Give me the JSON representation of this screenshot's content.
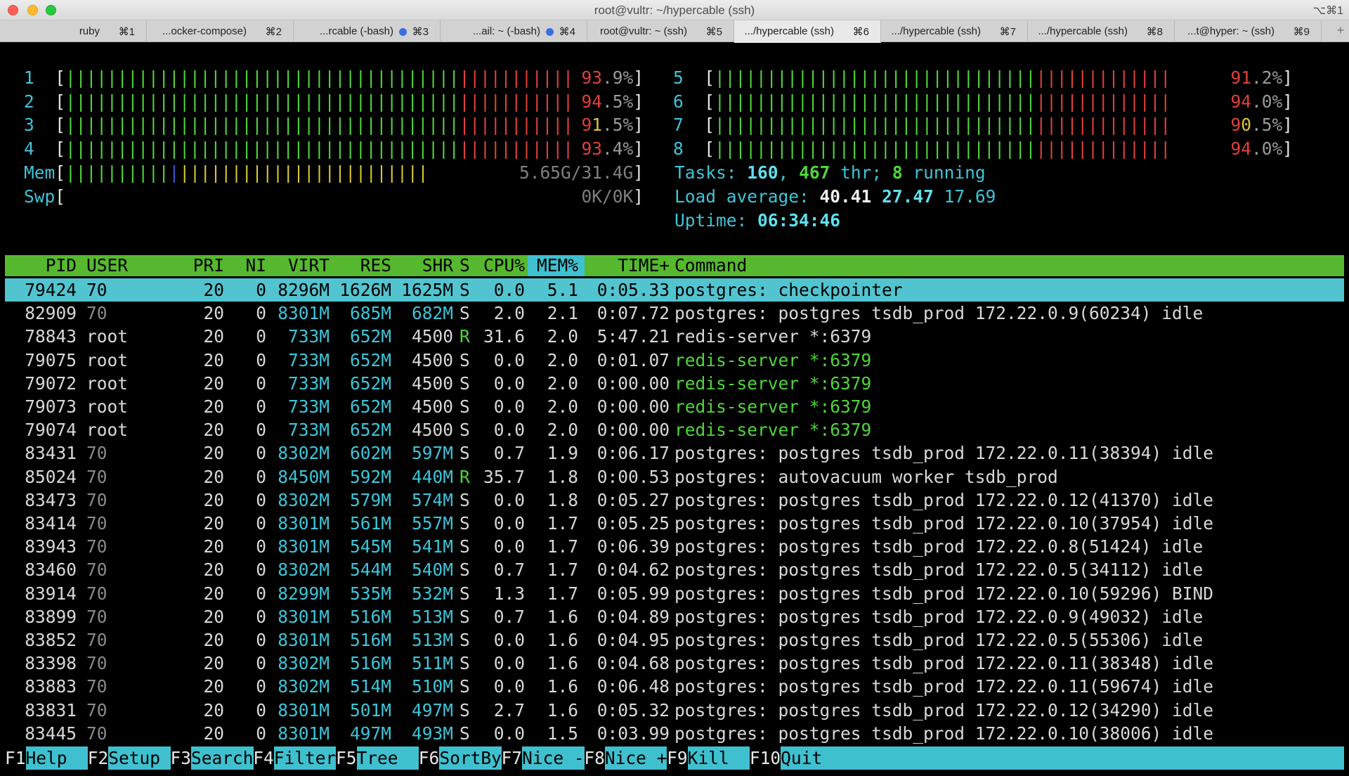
{
  "window": {
    "title": "root@vultr: ~/hypercable (ssh)",
    "shortcut": "⌥⌘1"
  },
  "tabs": [
    {
      "label": "ruby",
      "key": "⌘1",
      "dot": false,
      "active": false
    },
    {
      "label": "...ocker-compose)",
      "key": "⌘2",
      "dot": false,
      "active": false
    },
    {
      "label": "...rcable (-bash)",
      "key": "⌘3",
      "dot": true,
      "active": false
    },
    {
      "label": "...ail: ~ (-bash)",
      "key": "⌘4",
      "dot": true,
      "active": false
    },
    {
      "label": "root@vultr: ~ (ssh)",
      "key": "⌘5",
      "dot": false,
      "active": false
    },
    {
      "label": ".../hypercable (ssh)",
      "key": "⌘6",
      "dot": false,
      "active": true
    },
    {
      "label": ".../hypercable (ssh)",
      "key": "⌘7",
      "dot": false,
      "active": false
    },
    {
      "label": ".../hypercable (ssh)",
      "key": "⌘8",
      "dot": false,
      "active": false
    },
    {
      "label": "...t@hyper: ~ (ssh)",
      "key": "⌘9",
      "dot": false,
      "active": false
    }
  ],
  "cpus": [
    {
      "id": "1",
      "value": "93.9%]",
      "green": 38,
      "red": 11,
      "yellow": 0
    },
    {
      "id": "2",
      "value": "94.5%]",
      "green": 38,
      "red": 11,
      "yellow": 0
    },
    {
      "id": "3",
      "value": "91.5%]",
      "green": 38,
      "red": 11,
      "yellow": 1
    },
    {
      "id": "4",
      "value": "93.4%]",
      "green": 38,
      "red": 11,
      "yellow": 0
    },
    {
      "id": "5",
      "value": "91.2%]",
      "green": 31,
      "red": 13,
      "yellow": 0
    },
    {
      "id": "6",
      "value": "94.0%]",
      "green": 31,
      "red": 13,
      "yellow": 0
    },
    {
      "id": "7",
      "value": "90.5%]",
      "green": 31,
      "red": 13,
      "yellow": 1
    },
    {
      "id": "8",
      "value": "94.0%]",
      "green": 31,
      "red": 13,
      "yellow": 0
    }
  ],
  "mem": {
    "label": "Mem",
    "value": "5.65G/31.4G]",
    "green": 10,
    "blue": 1,
    "yellow": 24
  },
  "swp": {
    "label": "Swp",
    "value": "0K/0K]"
  },
  "tasks": {
    "label": "Tasks:",
    "count": "160",
    "thr": "467",
    "thr_label": "thr;",
    "running": "8",
    "running_label": "running"
  },
  "load": {
    "label": "Load average:",
    "one": "40.41",
    "five": "27.47",
    "fifteen": "17.69"
  },
  "uptime": {
    "label": "Uptime:",
    "value": "06:34:46"
  },
  "columns": {
    "pid": "PID",
    "user": "USER",
    "pri": "PRI",
    "ni": "NI",
    "virt": "VIRT",
    "res": "RES",
    "shr": "SHR",
    "s": "S",
    "cpu": "CPU%",
    "mem": "MEM%",
    "time": "TIME+",
    "command": "Command"
  },
  "processes": [
    {
      "pid": "79424",
      "user": "70",
      "pri": "20",
      "ni": "0",
      "virt": "8296M",
      "res": "1626M",
      "shr": "1625M",
      "s": "S",
      "cpu": "0.0",
      "mem": "5.1",
      "time": "0:05.33",
      "command": "postgres: checkpointer",
      "thread": false
    },
    {
      "pid": "82909",
      "user": "70",
      "pri": "20",
      "ni": "0",
      "virt": "8301M",
      "res": "685M",
      "shr": "682M",
      "s": "S",
      "cpu": "2.0",
      "mem": "2.1",
      "time": "0:07.72",
      "command": "postgres: postgres tsdb_prod 172.22.0.9(60234) idle",
      "thread": false
    },
    {
      "pid": "78843",
      "user": "root",
      "pri": "20",
      "ni": "0",
      "virt": "733M",
      "res": "652M",
      "shr": "4500",
      "s": "R",
      "cpu": "31.6",
      "mem": "2.0",
      "time": "5:47.21",
      "command": "redis-server *:6379",
      "thread": false
    },
    {
      "pid": "79075",
      "user": "root",
      "pri": "20",
      "ni": "0",
      "virt": "733M",
      "res": "652M",
      "shr": "4500",
      "s": "S",
      "cpu": "0.0",
      "mem": "2.0",
      "time": "0:01.07",
      "command": "redis-server *:6379",
      "thread": true
    },
    {
      "pid": "79072",
      "user": "root",
      "pri": "20",
      "ni": "0",
      "virt": "733M",
      "res": "652M",
      "shr": "4500",
      "s": "S",
      "cpu": "0.0",
      "mem": "2.0",
      "time": "0:00.00",
      "command": "redis-server *:6379",
      "thread": true
    },
    {
      "pid": "79073",
      "user": "root",
      "pri": "20",
      "ni": "0",
      "virt": "733M",
      "res": "652M",
      "shr": "4500",
      "s": "S",
      "cpu": "0.0",
      "mem": "2.0",
      "time": "0:00.00",
      "command": "redis-server *:6379",
      "thread": true
    },
    {
      "pid": "79074",
      "user": "root",
      "pri": "20",
      "ni": "0",
      "virt": "733M",
      "res": "652M",
      "shr": "4500",
      "s": "S",
      "cpu": "0.0",
      "mem": "2.0",
      "time": "0:00.00",
      "command": "redis-server *:6379",
      "thread": true
    },
    {
      "pid": "83431",
      "user": "70",
      "pri": "20",
      "ni": "0",
      "virt": "8302M",
      "res": "602M",
      "shr": "597M",
      "s": "S",
      "cpu": "0.7",
      "mem": "1.9",
      "time": "0:06.17",
      "command": "postgres: postgres tsdb_prod 172.22.0.11(38394) idle",
      "thread": false
    },
    {
      "pid": "85024",
      "user": "70",
      "pri": "20",
      "ni": "0",
      "virt": "8450M",
      "res": "592M",
      "shr": "440M",
      "s": "R",
      "cpu": "35.7",
      "mem": "1.8",
      "time": "0:00.53",
      "command": "postgres: autovacuum worker tsdb_prod",
      "thread": false
    },
    {
      "pid": "83473",
      "user": "70",
      "pri": "20",
      "ni": "0",
      "virt": "8302M",
      "res": "579M",
      "shr": "574M",
      "s": "S",
      "cpu": "0.0",
      "mem": "1.8",
      "time": "0:05.27",
      "command": "postgres: postgres tsdb_prod 172.22.0.12(41370) idle",
      "thread": false
    },
    {
      "pid": "83414",
      "user": "70",
      "pri": "20",
      "ni": "0",
      "virt": "8301M",
      "res": "561M",
      "shr": "557M",
      "s": "S",
      "cpu": "0.0",
      "mem": "1.7",
      "time": "0:05.25",
      "command": "postgres: postgres tsdb_prod 172.22.0.10(37954) idle",
      "thread": false
    },
    {
      "pid": "83943",
      "user": "70",
      "pri": "20",
      "ni": "0",
      "virt": "8301M",
      "res": "545M",
      "shr": "541M",
      "s": "S",
      "cpu": "0.0",
      "mem": "1.7",
      "time": "0:06.39",
      "command": "postgres: postgres tsdb_prod 172.22.0.8(51424) idle",
      "thread": false
    },
    {
      "pid": "83460",
      "user": "70",
      "pri": "20",
      "ni": "0",
      "virt": "8302M",
      "res": "544M",
      "shr": "540M",
      "s": "S",
      "cpu": "0.7",
      "mem": "1.7",
      "time": "0:04.62",
      "command": "postgres: postgres tsdb_prod 172.22.0.5(34112) idle",
      "thread": false
    },
    {
      "pid": "83914",
      "user": "70",
      "pri": "20",
      "ni": "0",
      "virt": "8299M",
      "res": "535M",
      "shr": "532M",
      "s": "S",
      "cpu": "1.3",
      "mem": "1.7",
      "time": "0:05.99",
      "command": "postgres: postgres tsdb_prod 172.22.0.10(59296) BIND",
      "thread": false
    },
    {
      "pid": "83899",
      "user": "70",
      "pri": "20",
      "ni": "0",
      "virt": "8301M",
      "res": "516M",
      "shr": "513M",
      "s": "S",
      "cpu": "0.7",
      "mem": "1.6",
      "time": "0:04.89",
      "command": "postgres: postgres tsdb_prod 172.22.0.9(49032) idle",
      "thread": false
    },
    {
      "pid": "83852",
      "user": "70",
      "pri": "20",
      "ni": "0",
      "virt": "8301M",
      "res": "516M",
      "shr": "513M",
      "s": "S",
      "cpu": "0.0",
      "mem": "1.6",
      "time": "0:04.95",
      "command": "postgres: postgres tsdb_prod 172.22.0.5(55306) idle",
      "thread": false
    },
    {
      "pid": "83398",
      "user": "70",
      "pri": "20",
      "ni": "0",
      "virt": "8302M",
      "res": "516M",
      "shr": "511M",
      "s": "S",
      "cpu": "0.0",
      "mem": "1.6",
      "time": "0:04.68",
      "command": "postgres: postgres tsdb_prod 172.22.0.11(38348) idle",
      "thread": false
    },
    {
      "pid": "83883",
      "user": "70",
      "pri": "20",
      "ni": "0",
      "virt": "8302M",
      "res": "514M",
      "shr": "510M",
      "s": "S",
      "cpu": "0.0",
      "mem": "1.6",
      "time": "0:06.48",
      "command": "postgres: postgres tsdb_prod 172.22.0.11(59674) idle",
      "thread": false
    },
    {
      "pid": "83831",
      "user": "70",
      "pri": "20",
      "ni": "0",
      "virt": "8301M",
      "res": "501M",
      "shr": "497M",
      "s": "S",
      "cpu": "2.7",
      "mem": "1.6",
      "time": "0:05.32",
      "command": "postgres: postgres tsdb_prod 172.22.0.12(34290) idle",
      "thread": false
    },
    {
      "pid": "83445",
      "user": "70",
      "pri": "20",
      "ni": "0",
      "virt": "8301M",
      "res": "497M",
      "shr": "493M",
      "s": "S",
      "cpu": "0.0",
      "mem": "1.5",
      "time": "0:03.99",
      "command": "postgres: postgres tsdb_prod 172.22.0.10(38006) idle",
      "thread": false
    }
  ],
  "fkeys": [
    {
      "key": "F1",
      "label": "Help  "
    },
    {
      "key": "F2",
      "label": "Setup "
    },
    {
      "key": "F3",
      "label": "Search"
    },
    {
      "key": "F4",
      "label": "Filter"
    },
    {
      "key": "F5",
      "label": "Tree  "
    },
    {
      "key": "F6",
      "label": "SortBy"
    },
    {
      "key": "F7",
      "label": "Nice -"
    },
    {
      "key": "F8",
      "label": "Nice +"
    },
    {
      "key": "F9",
      "label": "Kill  "
    },
    {
      "key": "F10",
      "label": "Quit"
    }
  ],
  "colors": {
    "header_bg": "#56b82e",
    "selected_bg": "#52c4cf",
    "fkey_bg": "#3fc0cf",
    "meter_green": "#4fd63a",
    "meter_red": "#e0403a",
    "meter_yellow": "#d9c832"
  }
}
